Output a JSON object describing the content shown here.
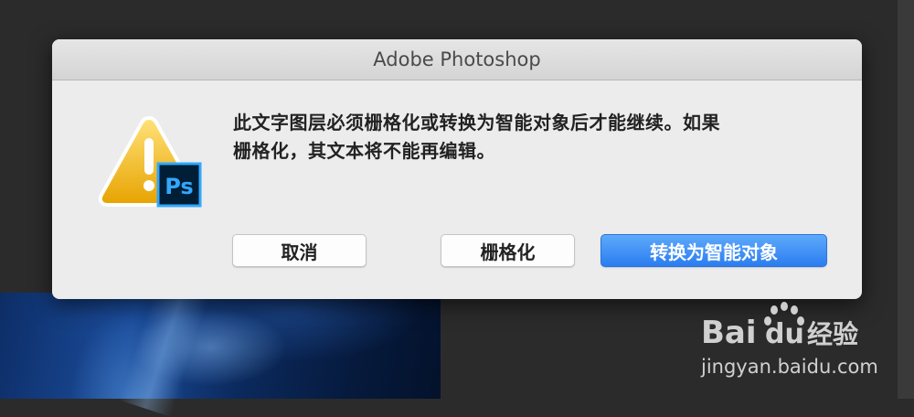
{
  "dialog": {
    "title": "Adobe Photoshop",
    "message_line1": "此文字图层必须栅格化或转换为智能对象后才能继续。如果",
    "message_line2": "栅格化，其文本将不能再编辑。",
    "icon": "warning-icon",
    "app_badge": "Ps",
    "buttons": {
      "cancel": "取消",
      "rasterize": "栅格化",
      "convert": "转换为智能对象"
    },
    "colors": {
      "primary_button": "#2b7df0",
      "warning": "#f2b705",
      "ps_badge": "#31a8ff"
    }
  },
  "watermark": {
    "brand_bai": "Bai",
    "brand_du": "du",
    "brand_cn": "经验",
    "site": "jingyan.baidu.com"
  }
}
